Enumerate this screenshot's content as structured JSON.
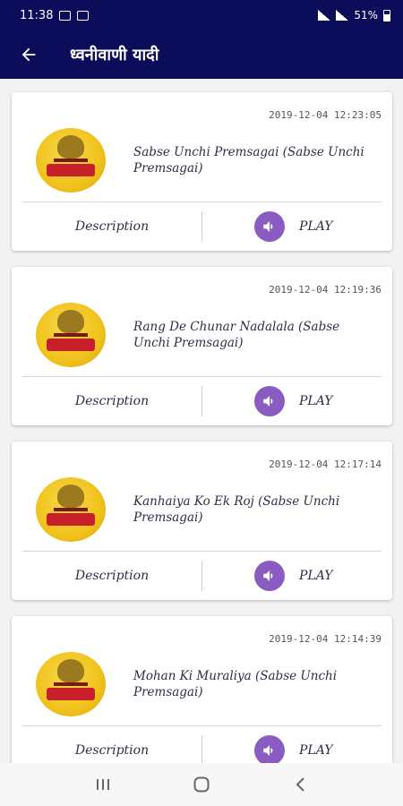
{
  "status_bar": {
    "time": "11:38",
    "battery": "51%"
  },
  "app_bar": {
    "title": "ध्वनीवाणी यादी"
  },
  "cards": [
    {
      "timestamp": "2019-12-04 12:23:05",
      "title": "Sabse Unchi Premsagai (Sabse Unchi Premsagai)",
      "description_label": "Description",
      "play_label": "PLAY"
    },
    {
      "timestamp": "2019-12-04 12:19:36",
      "title": "Rang De Chunar Nadalala (Sabse Unchi Premsagai)",
      "description_label": "Description",
      "play_label": "PLAY"
    },
    {
      "timestamp": "2019-12-04 12:17:14",
      "title": "Kanhaiya Ko Ek Roj (Sabse Unchi Premsagai)",
      "description_label": "Description",
      "play_label": "PLAY"
    },
    {
      "timestamp": "2019-12-04 12:14:39",
      "title": "Mohan Ki Muraliya (Sabse Unchi Premsagai)",
      "description_label": "Description",
      "play_label": "PLAY"
    }
  ],
  "colors": {
    "app_bar": "#0b0c5a",
    "accent": "#8a5cc2",
    "thumbnail": "#f1c21c"
  }
}
